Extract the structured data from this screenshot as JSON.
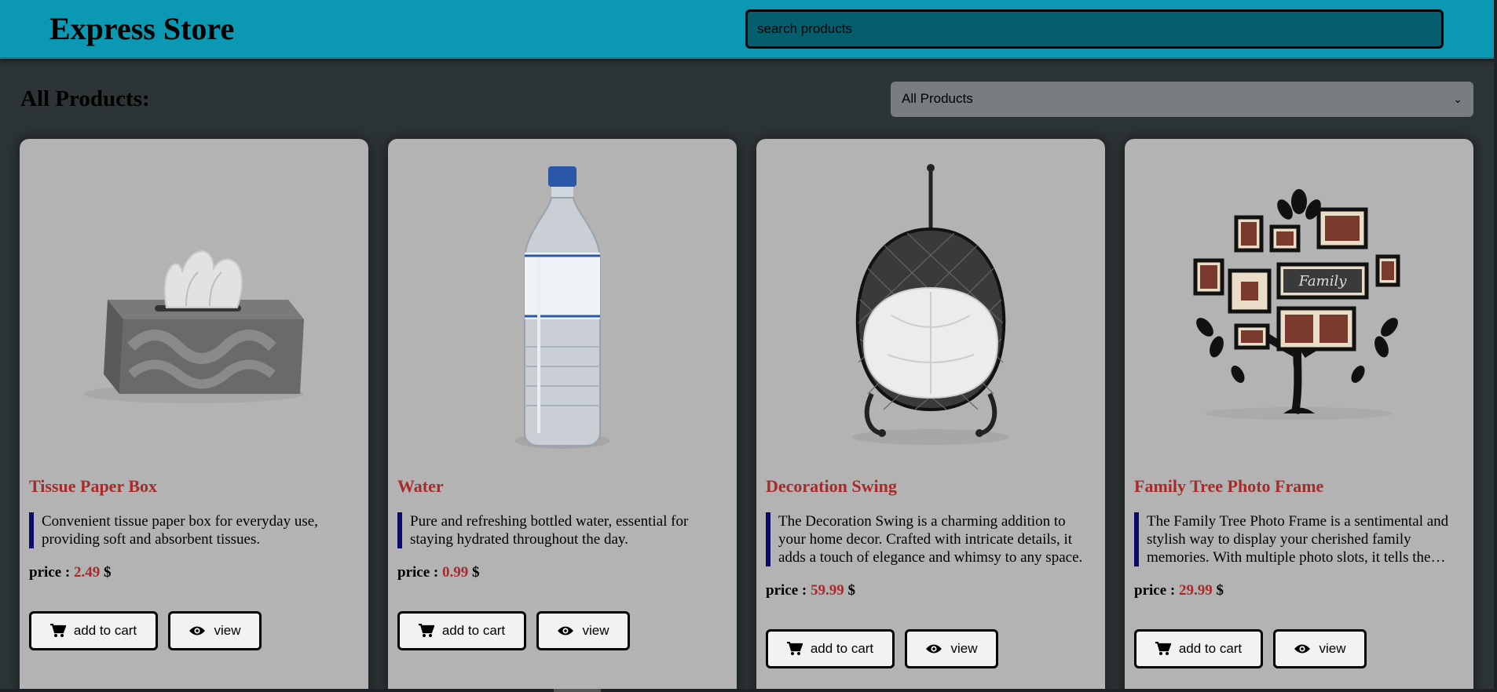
{
  "header": {
    "brand": "Express Store",
    "search_placeholder": "search products"
  },
  "toolbar": {
    "title": "All Products:",
    "filter_selected": "All Products"
  },
  "products": [
    {
      "title": "Tissue Paper Box",
      "description": "Convenient tissue paper box for everyday use, providing soft and absorbent tissues.",
      "price_label": "price :",
      "price": "2.49",
      "currency": "$",
      "cart_label": "add to cart",
      "view_label": "view"
    },
    {
      "title": "Water",
      "description": "Pure and refreshing bottled water, essential for staying hydrated throughout the day.",
      "price_label": "price :",
      "price": "0.99",
      "currency": "$",
      "cart_label": "add to cart",
      "view_label": "view"
    },
    {
      "title": "Decoration Swing",
      "description": "The Decoration Swing is a charming addition to your home decor. Crafted with intricate details, it adds a touch of elegance and whimsy to any space.",
      "price_label": "price :",
      "price": "59.99",
      "currency": "$",
      "cart_label": "add to cart",
      "view_label": "view"
    },
    {
      "title": "Family Tree Photo Frame",
      "description": "The Family Tree Photo Frame is a sentimental and stylish way to display your cherished family memories. With multiple photo slots, it tells the story of your family.",
      "price_label": "price :",
      "price": "29.99",
      "currency": "$",
      "cart_label": "add to cart",
      "view_label": "view"
    }
  ],
  "frame_text": "Family",
  "colors": {
    "header_bg": "#0a98b2",
    "page_bg": "#2d3436",
    "card_bg": "#b3b3b3",
    "accent_red": "#a82a2a",
    "quote_bar": "#0a0a6a"
  }
}
